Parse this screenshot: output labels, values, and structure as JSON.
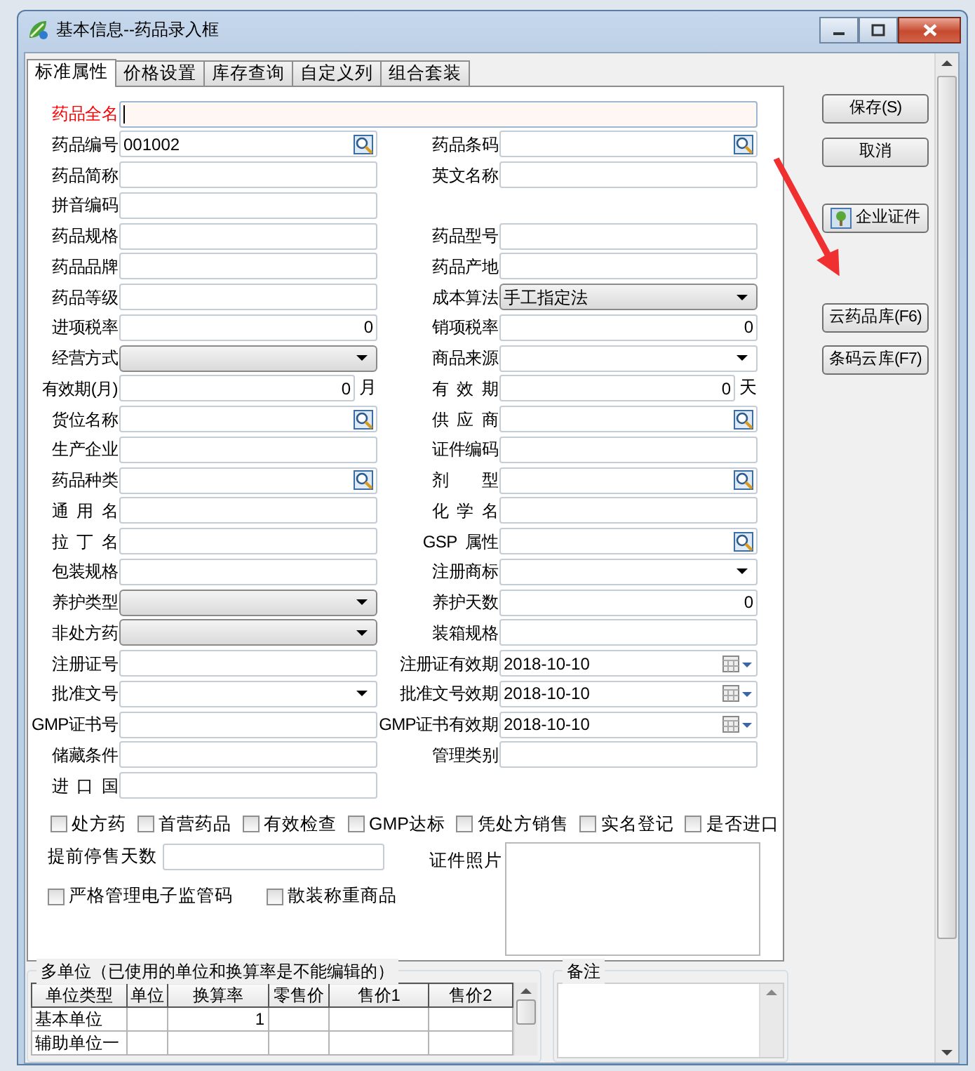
{
  "window": {
    "title": "基本信息--药品录入框"
  },
  "tabs": [
    {
      "label": "标准属性",
      "selected": true
    },
    {
      "label": "价格设置",
      "selected": false
    },
    {
      "label": "库存查询",
      "selected": false
    },
    {
      "label": "自定义列",
      "selected": false
    },
    {
      "label": "组合套装",
      "selected": false
    }
  ],
  "full_name": {
    "label": "药品全名",
    "required": true,
    "focused": true
  },
  "rows": [
    {
      "left": {
        "label": "药品编号",
        "kind": "lookup",
        "value": "001002"
      },
      "right": {
        "label": "药品条码",
        "kind": "lookup"
      }
    },
    {
      "left": {
        "label": "药品简称",
        "kind": "text"
      },
      "right": {
        "label": "英文名称",
        "kind": "text"
      }
    },
    {
      "left": {
        "label": "拼音编码",
        "kind": "text"
      }
    },
    {
      "left": {
        "label": "药品规格",
        "kind": "text"
      },
      "right": {
        "label": "药品型号",
        "kind": "text"
      }
    },
    {
      "left": {
        "label": "药品品牌",
        "kind": "text"
      },
      "right": {
        "label": "药品产地",
        "kind": "text"
      }
    },
    {
      "left": {
        "label": "药品等级",
        "kind": "text"
      },
      "right": {
        "label": "成本算法",
        "kind": "select",
        "value": "手工指定法"
      }
    },
    {
      "left": {
        "label": "进项税率",
        "kind": "number",
        "value": "0"
      },
      "right": {
        "label": "销项税率",
        "kind": "number",
        "value": "0"
      }
    },
    {
      "left": {
        "label": "经营方式",
        "kind": "select"
      },
      "right": {
        "label": "商品来源",
        "kind": "dropdown"
      }
    },
    {
      "left": {
        "label": "有效期(月)",
        "kind": "number",
        "value": "0",
        "unit": "月"
      },
      "right": {
        "label": "有 效 期",
        "kind": "number",
        "value": "0",
        "unit": "天"
      }
    },
    {
      "left": {
        "label": "货位名称",
        "kind": "lookup"
      },
      "right": {
        "label": "供 应 商",
        "kind": "lookup"
      }
    },
    {
      "left": {
        "label": "生产企业",
        "kind": "text"
      },
      "right": {
        "label": "证件编码",
        "kind": "text"
      }
    },
    {
      "left": {
        "label": "药品种类",
        "kind": "lookup"
      },
      "right": {
        "label": "剂　　型",
        "kind": "lookup"
      }
    },
    {
      "left": {
        "label": "通 用 名",
        "kind": "text"
      },
      "right": {
        "label": "化 学 名",
        "kind": "text"
      }
    },
    {
      "left": {
        "label": "拉 丁 名",
        "kind": "text"
      },
      "right": {
        "label": "GSP 属性",
        "kind": "lookup"
      }
    },
    {
      "left": {
        "label": "包装规格",
        "kind": "text"
      },
      "right": {
        "label": "注册商标",
        "kind": "dropdown"
      }
    },
    {
      "left": {
        "label": "养护类型",
        "kind": "select"
      },
      "right": {
        "label": "养护天数",
        "kind": "number",
        "value": "0"
      }
    },
    {
      "left": {
        "label": "非处方药",
        "kind": "select"
      },
      "right": {
        "label": "装箱规格",
        "kind": "text"
      }
    },
    {
      "left": {
        "label": "注册证号",
        "kind": "text"
      },
      "right": {
        "label": "注册证有效期",
        "kind": "date",
        "value": "2018-10-10"
      }
    },
    {
      "left": {
        "label": "批准文号",
        "kind": "dropdown"
      },
      "right": {
        "label": "批准文号效期",
        "kind": "date",
        "value": "2018-10-10"
      }
    },
    {
      "left": {
        "label": "GMP证书号",
        "kind": "text"
      },
      "right": {
        "label": "GMP证书有效期",
        "kind": "date",
        "value": "2018-10-10"
      }
    },
    {
      "left": {
        "label": "储藏条件",
        "kind": "text"
      },
      "right": {
        "label": "管理类别",
        "kind": "text"
      }
    },
    {
      "left": {
        "label": "进 口 国",
        "kind": "text"
      }
    }
  ],
  "flags": [
    {
      "label": "处方药",
      "checked": false
    },
    {
      "label": "首营药品",
      "checked": false
    },
    {
      "label": "有效检查",
      "checked": false
    },
    {
      "label": "GMP达标",
      "checked": false
    },
    {
      "label": "凭处方销售",
      "checked": false
    },
    {
      "label": "实名登记",
      "checked": false
    },
    {
      "label": "是否进口",
      "checked": false
    }
  ],
  "stop_days": {
    "label": "提前停售天数"
  },
  "photo": {
    "label": "证件照片"
  },
  "more_flags": [
    {
      "label": "严格管理电子监管码",
      "checked": false
    },
    {
      "label": "散装称重商品",
      "checked": false
    }
  ],
  "units": {
    "title": "多单位（已使用的单位和换算率是不能编辑的）",
    "columns": [
      "单位类型",
      "单位",
      "换算率",
      "零售价",
      "售价1",
      "售价2"
    ],
    "rows": [
      [
        "基本单位",
        null,
        "1",
        null,
        null,
        null
      ],
      [
        "辅助单位一",
        null,
        null,
        null,
        null,
        null
      ]
    ]
  },
  "notes": {
    "title": "备注"
  },
  "buttons": [
    {
      "label": "保存(S)",
      "kind": "plain"
    },
    {
      "label": "取消",
      "kind": "plain"
    },
    {
      "label": "企业证件",
      "kind": "icon"
    },
    {
      "label": "云药品库(F6)",
      "kind": "plain"
    },
    {
      "label": "条码云库(F7)",
      "kind": "plain"
    }
  ]
}
